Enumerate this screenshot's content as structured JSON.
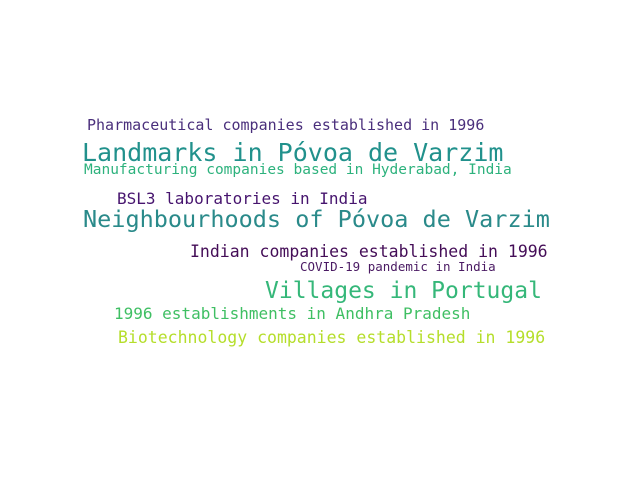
{
  "words": [
    {
      "text": "Pharmaceutical companies established in 1996",
      "color": "#4a2f7c"
    },
    {
      "text": "Landmarks in Póvoa de Varzim",
      "color": "#21918c"
    },
    {
      "text": "Manufacturing companies based in Hyderabad, India",
      "color": "#2db27d"
    },
    {
      "text": "BSL3 laboratories in India",
      "color": "#46146e"
    },
    {
      "text": "Neighbourhoods of Póvoa de Varzim",
      "color": "#2a8a8a"
    },
    {
      "text": "Indian companies established in 1996",
      "color": "#440d57"
    },
    {
      "text": "COVID-19 pandemic in India",
      "color": "#4a1a63"
    },
    {
      "text": "Villages in Portugal",
      "color": "#35b779"
    },
    {
      "text": "1996 establishments in Andhra Pradesh",
      "color": "#3fbf63"
    },
    {
      "text": "Biotechnology companies established in 1996",
      "color": "#b5de2b"
    }
  ]
}
